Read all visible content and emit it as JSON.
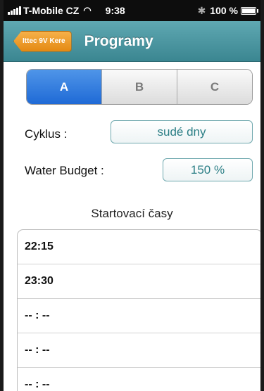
{
  "status_bar": {
    "carrier": "T-Mobile CZ",
    "time": "9:38",
    "battery": "100 %"
  },
  "nav": {
    "back_label": "Ittec 9V Kere",
    "title": "Programy"
  },
  "segments": [
    "A",
    "B",
    "C"
  ],
  "selected_segment": "A",
  "cycle": {
    "label": "Cyklus :",
    "value": "sudé dny"
  },
  "water_budget": {
    "label": "Water Budget :",
    "value": "150 %"
  },
  "start_times": {
    "title": "Startovací časy",
    "items": [
      "22:15",
      "23:30",
      "-- : --",
      "-- : --",
      "-- : --"
    ]
  },
  "colors": {
    "nav_bar": "#4a959f",
    "back_button": "#ec9a2a",
    "segment_active": "#2f7de0",
    "field_text": "#2c7f86"
  }
}
